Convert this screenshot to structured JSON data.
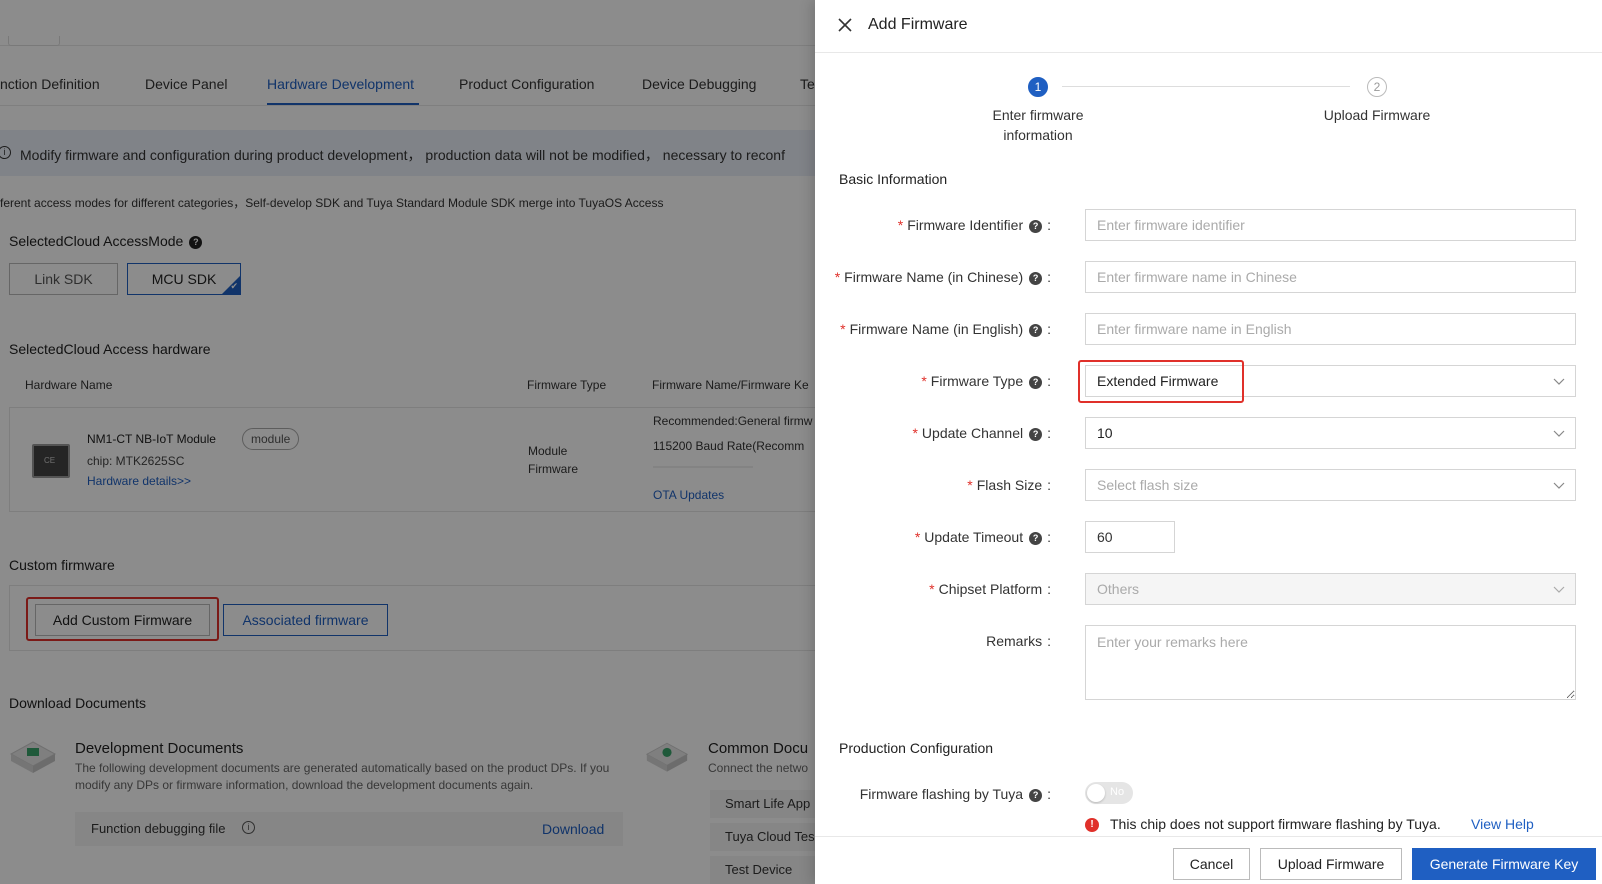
{
  "background": {
    "tabs": [
      "nction Definition",
      "Device Panel",
      "Hardware Development",
      "Product Configuration",
      "Device Debugging",
      "Te"
    ],
    "notice": "Modify firmware and configuration during product development， production data will not be modified， necessary to reconf",
    "subnote": "ferent access modes for different categories，Self-develop SDK and Tuya Standard Module SDK merge into TuyaOS Access",
    "access_mode_title": "SelectedCloud AccessMode",
    "modes": [
      "Link SDK",
      "MCU SDK"
    ],
    "hardware_title": "SelectedCloud Access hardware",
    "table_headers": [
      "Hardware Name",
      "Firmware Type",
      "Firmware Name/Firmware Ke"
    ],
    "hardware": {
      "name": "NM1-CT NB-IoT Module",
      "badge": "module",
      "chip": "chip: MTK2625SC",
      "details_link": "Hardware details>>",
      "firmware_type": "Module Firmware",
      "recommended": "Recommended:General firmw",
      "baud": "115200 Baud Rate(Recomm",
      "ota": "OTA Updates"
    },
    "custom_title": "Custom firmware",
    "add_custom_btn": "Add Custom Firmware",
    "associated_btn": "Associated firmware",
    "download_title": "Download Documents",
    "dev_docs_title": "Development Documents",
    "dev_docs_desc": "The following development documents are generated automatically based on the product DPs. If you modify any DPs or firmware information, download the development documents again.",
    "debug_file": "Function debugging file",
    "download_link": "Download",
    "common_title": "Common Docu",
    "common_desc": "Connect the netwo",
    "common_items": [
      "Smart Life App",
      "Tuya Cloud Tes",
      "Test Device"
    ]
  },
  "drawer": {
    "title": "Add Firmware",
    "steps": [
      {
        "num": "1",
        "label": "Enter firmware information"
      },
      {
        "num": "2",
        "label": "Upload Firmware"
      }
    ],
    "basic_title": "Basic Information",
    "fields": {
      "identifier": {
        "label": "Firmware Identifier",
        "placeholder": "Enter firmware identifier"
      },
      "name_cn": {
        "label": "Firmware Name (in Chinese)",
        "placeholder": "Enter firmware name in Chinese"
      },
      "name_en": {
        "label": "Firmware Name (in English)",
        "placeholder": "Enter firmware name in English"
      },
      "type": {
        "label": "Firmware Type",
        "value": "Extended Firmware"
      },
      "channel": {
        "label": "Update Channel",
        "value": "10"
      },
      "flash": {
        "label": "Flash Size",
        "placeholder": "Select flash size"
      },
      "timeout": {
        "label": "Update Timeout",
        "value": "60"
      },
      "chipset": {
        "label": "Chipset Platform",
        "value": "Others"
      },
      "remarks": {
        "label": "Remarks",
        "placeholder": "Enter your remarks here"
      }
    },
    "production_title": "Production Configuration",
    "flashing_label": "Firmware flashing by Tuya",
    "toggle_label": "No",
    "warning_text": "This chip does not support firmware flashing by Tuya.",
    "view_help": "View Help",
    "buttons": {
      "cancel": "Cancel",
      "upload": "Upload Firmware",
      "generate": "Generate Firmware Key"
    }
  },
  "colors": {
    "accent": "#1f5fc2",
    "highlight": "#e0302a",
    "required": "#e0302a"
  }
}
